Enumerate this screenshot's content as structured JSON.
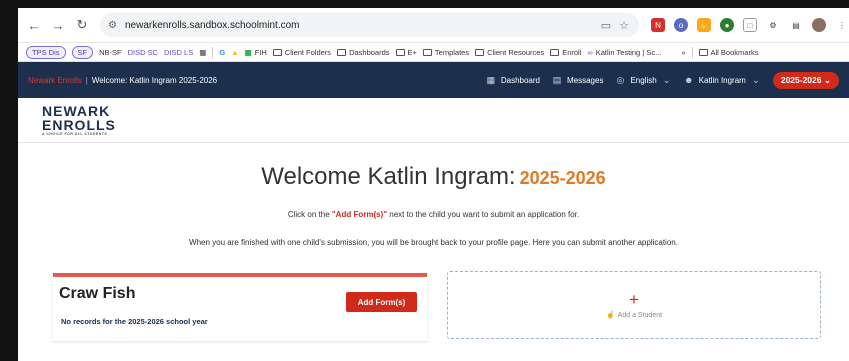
{
  "browser": {
    "url": "newarkenrolls.sandbox.schoolmint.com",
    "bookmarks": [
      "TPS Dis",
      "SF",
      "NB-SF",
      "DISD SC",
      "DISD LS",
      "FIH",
      "Client Folders",
      "Dashboards",
      "E+",
      "Templates",
      "Client Resources",
      "Enroll",
      "Katlin Testing | Sc...",
      "All Bookmarks"
    ]
  },
  "header": {
    "brand": "Newark Enrolls",
    "title": "Welcome: Katlin Ingram 2025-2026",
    "dashboard": "Dashboard",
    "messages": "Messages",
    "language": "English",
    "user": "Katlin Ingram",
    "year": "2025-2026"
  },
  "logo": {
    "line1": "NEWARK",
    "line2": "ENROLLS",
    "tagline": "A CHOICE FOR ALL STUDENTS"
  },
  "main": {
    "welcome": "Welcome Katlin Ingram:",
    "year": "2025-2026",
    "instr_pre": "Click on the ",
    "instr_highlight": "\"Add Form(s)\"",
    "instr_post": " next to the child you want to submit an application for.",
    "instr2": "When you are finished with one child's submission, you will be brought back to your profile page. Here you can submit another application."
  },
  "student": {
    "name": "Craw Fish",
    "no_records": "No records for the 2025-2026 school year",
    "add_form": "Add Form(s)"
  },
  "add_student": {
    "label": "Add a Student"
  }
}
